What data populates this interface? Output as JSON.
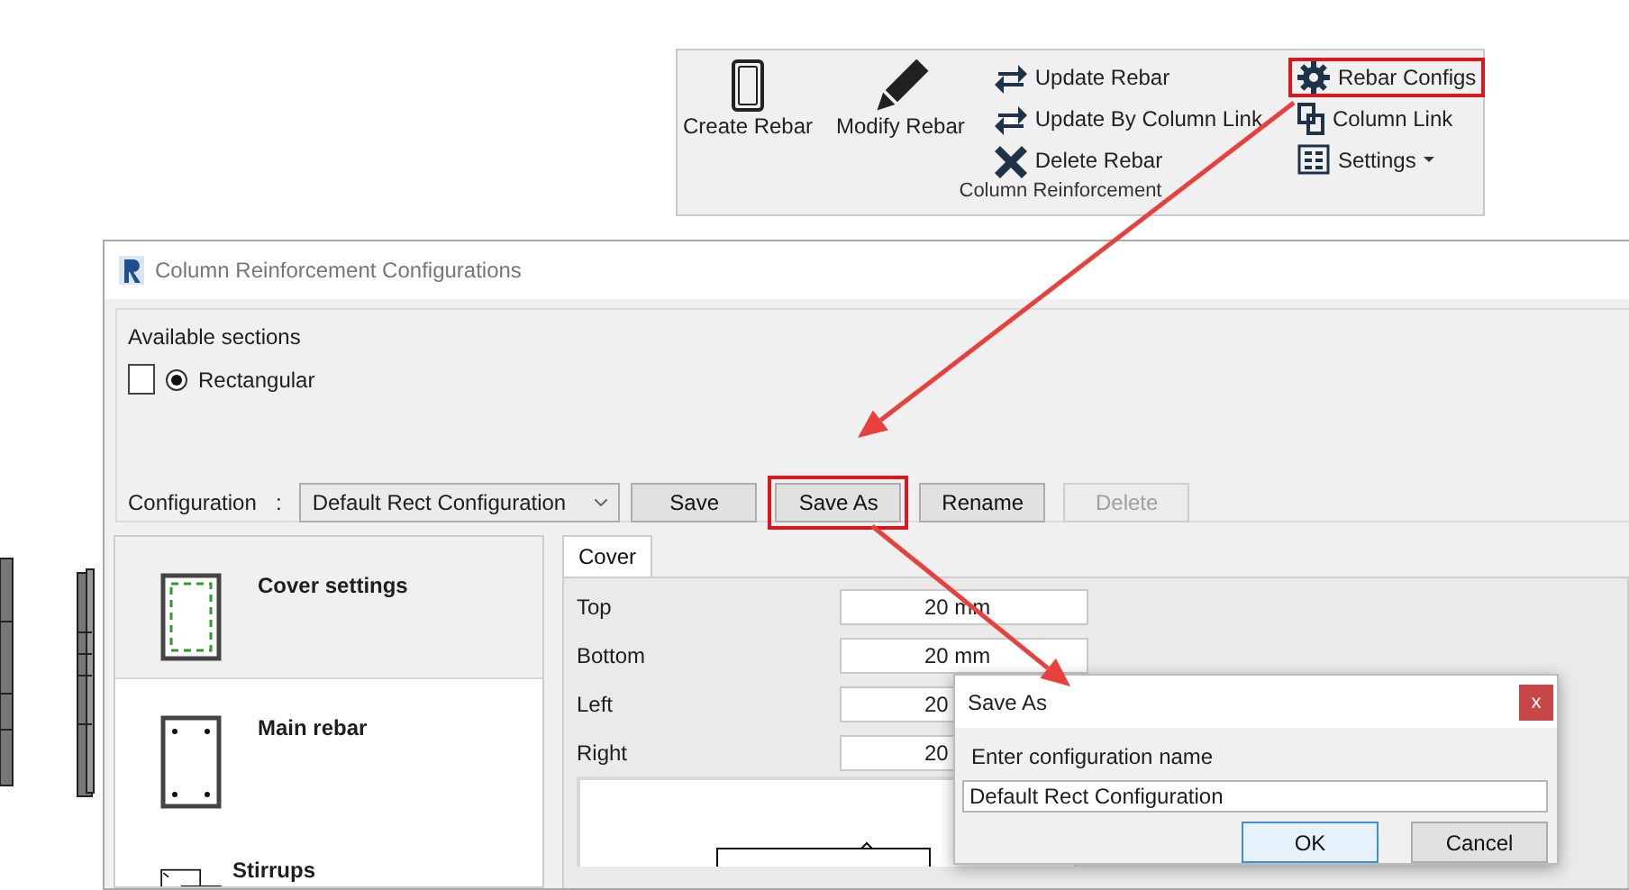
{
  "ribbon": {
    "large_tools": [
      {
        "label": "Create Rebar",
        "kind": "column"
      },
      {
        "label": "Modify Rebar",
        "kind": "pencil"
      }
    ],
    "tool_columns": [
      {
        "tools": [
          {
            "label": "Update Rebar",
            "kind": "swap",
            "highlighted": false,
            "dropdown": false
          },
          {
            "label": "Update By Column Link",
            "kind": "swap-link",
            "highlighted": false,
            "dropdown": false
          },
          {
            "label": "Delete Rebar",
            "kind": "delete",
            "highlighted": false,
            "dropdown": false
          }
        ]
      },
      {
        "tools": [
          {
            "label": "Rebar Configs",
            "kind": "gear",
            "highlighted": true,
            "dropdown": false
          },
          {
            "label": "Column Link",
            "kind": "link",
            "highlighted": false,
            "dropdown": false
          },
          {
            "label": "Settings",
            "kind": "settings",
            "highlighted": false,
            "dropdown": true
          }
        ]
      }
    ],
    "panel_title": "Column Reinforcement"
  },
  "dialog": {
    "title": "Column Reinforcement Configurations",
    "sections_label": "Available sections",
    "sections": [
      {
        "label": "Rectangular",
        "selected": true,
        "checked": false
      }
    ],
    "configuration_label": "Configuration",
    "separator": ":",
    "configuration": "Default Rect Configuration",
    "buttons": [
      {
        "label": "Save",
        "disabled": false,
        "highlighted": false
      },
      {
        "label": "Save As",
        "disabled": false,
        "highlighted": true
      },
      {
        "label": "Rename",
        "disabled": false,
        "highlighted": false
      },
      {
        "label": "Delete",
        "disabled": true,
        "highlighted": false
      }
    ],
    "sidebar": [
      {
        "label": "Cover settings",
        "kind": "cover",
        "selected": true
      },
      {
        "label": "Main rebar",
        "kind": "main",
        "selected": false
      },
      {
        "label": "Stirrups",
        "kind": "stirrups",
        "selected": false
      }
    ],
    "tabs": [
      {
        "label": "Cover",
        "selected": true
      }
    ],
    "fields": [
      {
        "label": "Top",
        "value": "20 mm"
      },
      {
        "label": "Bottom",
        "value": "20 mm"
      },
      {
        "label": "Left",
        "value": "20"
      },
      {
        "label": "Right",
        "value": "20"
      }
    ]
  },
  "save_as": {
    "title": "Save As",
    "close": "x",
    "prompt": "Enter configuration name",
    "value": "Default Rect Configuration",
    "buttons": [
      {
        "label": "OK",
        "default": true
      },
      {
        "label": "Cancel",
        "default": false
      }
    ]
  }
}
